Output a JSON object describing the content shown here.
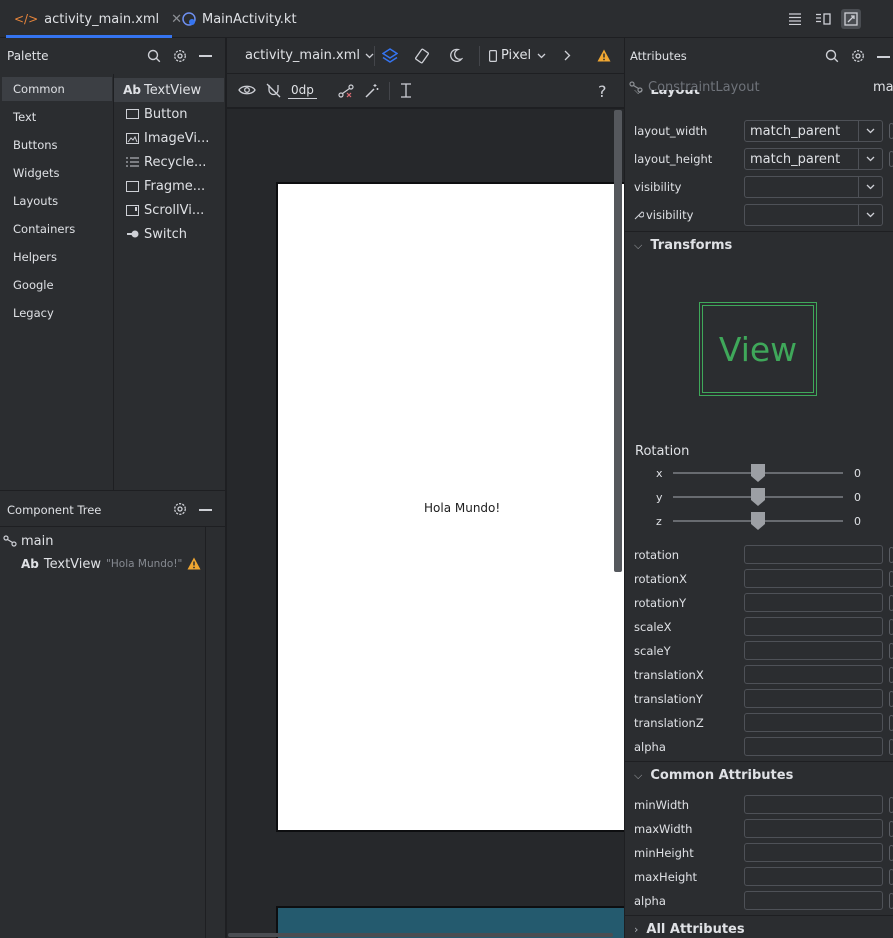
{
  "tabs": [
    {
      "label": "activity_main.xml",
      "active": true
    },
    {
      "label": "MainActivity.kt",
      "active": false
    }
  ],
  "palette": {
    "title": "Palette",
    "categories": [
      "Common",
      "Text",
      "Buttons",
      "Widgets",
      "Layouts",
      "Containers",
      "Helpers",
      "Google",
      "Legacy"
    ],
    "selected_category": "Common",
    "items": [
      {
        "icon": "Ab",
        "label": "TextView"
      },
      {
        "icon": "button-icon",
        "label": "Button"
      },
      {
        "icon": "image-icon",
        "label": "ImageVi..."
      },
      {
        "icon": "list-icon",
        "label": "Recycle..."
      },
      {
        "icon": "fragment-icon",
        "label": "Fragme..."
      },
      {
        "icon": "scroll-icon",
        "label": "ScrollVi..."
      },
      {
        "icon": "switch-icon",
        "label": "Switch"
      }
    ]
  },
  "component_tree": {
    "title": "Component Tree",
    "root": "main",
    "child": {
      "icon": "Ab",
      "label": "TextView",
      "text": "\"Hola Mundo!\""
    }
  },
  "design": {
    "file_label": "activity_main.xml",
    "device": "Pixel",
    "margin": "0dp",
    "help": "?",
    "preview_text": "Hola Mundo!"
  },
  "attributes": {
    "title": "Attributes",
    "component": "ConstraintLayout",
    "component_id": "mai",
    "layout_section": "Layout",
    "layout_rows": [
      {
        "label": "layout_width",
        "value": "match_parent"
      },
      {
        "label": "layout_height",
        "value": "match_parent"
      },
      {
        "label": "visibility",
        "value": ""
      },
      {
        "label": "visibility",
        "value": "",
        "tool": true
      }
    ],
    "transforms_section": "Transforms",
    "view_preview": "View",
    "rotation_title": "Rotation",
    "rotation_axes": [
      {
        "axis": "x",
        "value": "0"
      },
      {
        "axis": "y",
        "value": "0"
      },
      {
        "axis": "z",
        "value": "0"
      }
    ],
    "transform_rows": [
      "rotation",
      "rotationX",
      "rotationY",
      "scaleX",
      "scaleY",
      "translationX",
      "translationY",
      "translationZ",
      "alpha"
    ],
    "common_section": "Common Attributes",
    "common_rows": [
      "minWidth",
      "maxWidth",
      "minHeight",
      "maxHeight",
      "alpha"
    ],
    "all_section": "All Attributes"
  },
  "colors": {
    "accent": "#3574f0",
    "warning": "#f0a732",
    "view_green": "#3fa85a",
    "xml_icon": "#e8853b"
  }
}
